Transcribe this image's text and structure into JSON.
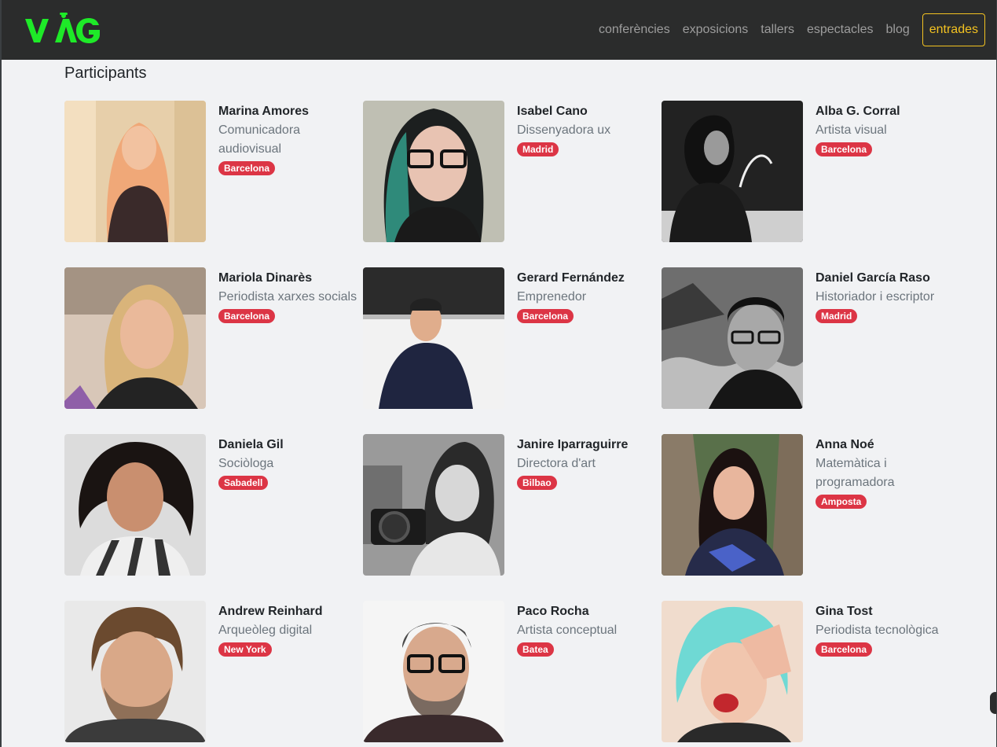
{
  "header": {
    "logo_text": "VAG",
    "nav": [
      "conferències",
      "exposicions",
      "tallers",
      "espectacles",
      "blog"
    ],
    "cta_label": "entrades",
    "colors": {
      "bg": "#2b2c2c",
      "logo": "#1eea28",
      "cta": "#f3c221",
      "link": "#9d9d9d"
    }
  },
  "section_title": "Participants",
  "colors": {
    "badge": "#dc3545",
    "name": "#212529",
    "role": "#6c757d",
    "page_bg": "#f1f2f4"
  },
  "participants": [
    {
      "name": "Marina Amores",
      "role": "Comunicadora audiovisual",
      "city": "Barcelona",
      "photo": "portrait-blonde-woman"
    },
    {
      "name": "Isabel Cano",
      "role": "Dissenyadora ux",
      "city": "Madrid",
      "photo": "portrait-woman-glasses-teal-hair"
    },
    {
      "name": "Alba G. Corral",
      "role": "Artista visual",
      "city": "Barcelona",
      "photo": "portrait-artist-bw"
    },
    {
      "name": "Mariola Dinarès",
      "role": "Periodista xarxes socials",
      "city": "Barcelona",
      "photo": "portrait-woman-blonde-bob"
    },
    {
      "name": "Gerard Fernández",
      "role": "Emprenedor",
      "city": "Barcelona",
      "photo": "portrait-man-dark-shirt"
    },
    {
      "name": "Daniel García Raso",
      "role": "Historiador i escriptor",
      "city": "Madrid",
      "photo": "portrait-man-glasses-bw"
    },
    {
      "name": "Daniela Gil",
      "role": "Sociòloga",
      "city": "Sabadell",
      "photo": "portrait-woman-curly-hair"
    },
    {
      "name": "Janire Iparraguirre",
      "role": "Directora d'art",
      "city": "Bilbao",
      "photo": "portrait-woman-camera-bw"
    },
    {
      "name": "Anna Noé",
      "role": "Matemàtica i programadora",
      "city": "Amposta",
      "photo": "portrait-woman-dark-hair-tree"
    },
    {
      "name": "Andrew Reinhard",
      "role": "Arqueòleg digital",
      "city": "New York",
      "photo": "portrait-man-beard"
    },
    {
      "name": "Paco Rocha",
      "role": "Artista conceptual",
      "city": "Batea",
      "photo": "portrait-man-glasses-beard"
    },
    {
      "name": "Gina Tost",
      "role": "Periodista tecnològica",
      "city": "Barcelona",
      "photo": "portrait-woman-turquoise-hair"
    }
  ]
}
